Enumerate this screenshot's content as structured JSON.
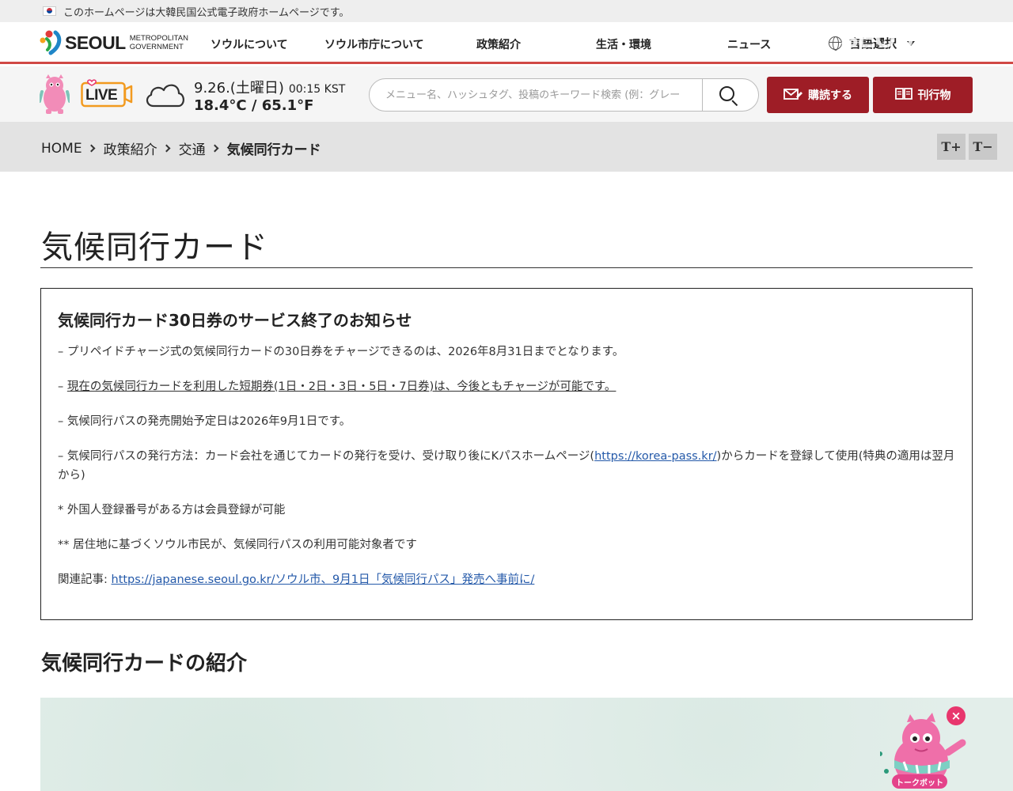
{
  "top_notice": {
    "text": "このホームページは大韓民国公式電子政府ホームページです。"
  },
  "header": {
    "logo": {
      "word": "SEOUL",
      "sub1": "METROPOLITAN",
      "sub2": "GOVERNMENT"
    },
    "nav": [
      "ソウルについて",
      "ソウル市庁について",
      "政策紹介",
      "生活・環境",
      "ニュース"
    ],
    "language": "言語選択",
    "accent_color": "#d04844"
  },
  "utility": {
    "live_label": "LIVE",
    "weather": {
      "date": "9.26.(土曜日)",
      "time": "00:15 KST",
      "temp": "18.4°C / 65.1°F",
      "icon": "cloud-icon"
    },
    "search": {
      "placeholder": "メニュー名、ハッシュタグ、投稿のキーワード検索 (例：グレー"
    },
    "subscribe_label": "購読する",
    "publications_label": "刊行物",
    "button_color": "#9e1d26"
  },
  "breadcrumb": {
    "items": [
      "HOME",
      "政策紹介",
      "交通",
      "気候同行カード"
    ],
    "text_plus": "T+",
    "text_minus": "T−"
  },
  "page": {
    "title": "気候同行カード",
    "notice": {
      "heading": "気候同行カード30日券のサービス終了のお知らせ",
      "p1": "– プリペイドチャージ式の気候同行カードの30日券をチャージできるのは、2026年8月31日までとなります。",
      "p2_prefix": "– ",
      "p2_underlined": "現在の気候同行カードを利用した短期券(1日・2日・3日・5日・7日券)は、今後ともチャージが可能です。",
      "p3": "– 気候同行パスの発売開始予定日は2026年9月1日です。",
      "p4_before": "– 気候同行パスの発行方法：カード会社を通じてカードの発行を受け、受け取り後にKパスホームページ(",
      "p4_link": "https://korea-pass.kr/",
      "p4_after": ")からカードを登録して使用(特典の適用は翌月から)",
      "p5": "* 外国人登録番号がある方は会員登録が可能",
      "p6": "** 居住地に基づくソウル市民が、気候同行パスの利用可能対象者です",
      "p7_label": "関連記事: ",
      "p7_link": "https://japanese.seoul.go.kr/ソウル市、9月1日「気候同行パス」発売へ事前に/"
    },
    "section_title": "気候同行カードの紹介"
  },
  "chatbot": {
    "label": "トークボット",
    "close": "×"
  }
}
